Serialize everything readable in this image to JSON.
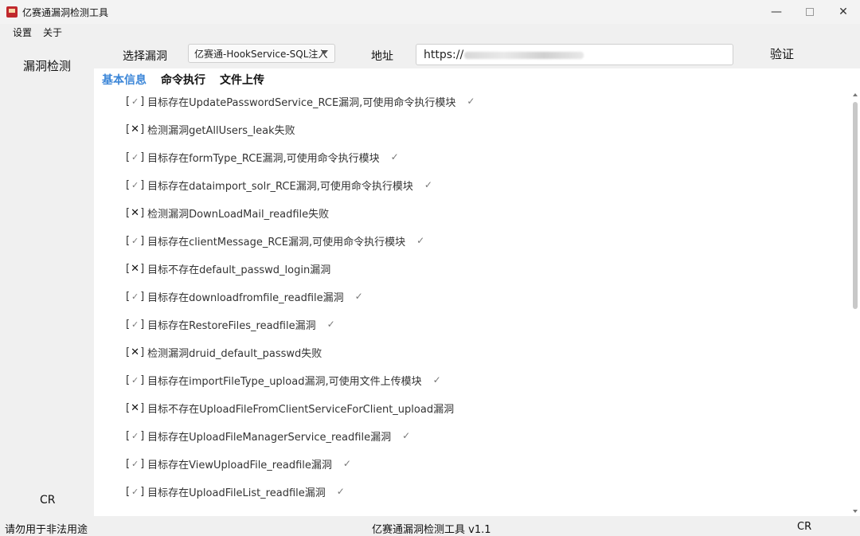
{
  "window": {
    "title": "亿赛通漏洞检测工具",
    "controls": {
      "minimize": "—",
      "maximize": "",
      "close": "✕"
    }
  },
  "menu": {
    "items": [
      "设置",
      "关于"
    ]
  },
  "leftnav": {
    "title": "漏洞检测",
    "footer": "CR"
  },
  "toolbar": {
    "select_label": "选择漏洞",
    "select_value": "亿赛通-HookService-SQL注入",
    "address_label": "地址",
    "address_value": "https://",
    "verify_label": "验证"
  },
  "tabs": [
    {
      "label": "基本信息",
      "active": true
    },
    {
      "label": "命令执行",
      "active": false
    },
    {
      "label": "文件上传",
      "active": false
    }
  ],
  "results": [
    {
      "status": "ok",
      "text": "目标存在UpdatePasswordService_RCE漏洞,可使用命令执行模块"
    },
    {
      "status": "fail",
      "text": "检测漏洞getAllUsers_leak失败"
    },
    {
      "status": "ok",
      "text": "目标存在formType_RCE漏洞,可使用命令执行模块"
    },
    {
      "status": "ok",
      "text": "目标存在dataimport_solr_RCE漏洞,可使用命令执行模块"
    },
    {
      "status": "fail",
      "text": "检测漏洞DownLoadMail_readfile失败"
    },
    {
      "status": "ok",
      "text": "目标存在clientMessage_RCE漏洞,可使用命令执行模块"
    },
    {
      "status": "fail",
      "text": "目标不存在default_passwd_login漏洞"
    },
    {
      "status": "ok",
      "text": "目标存在downloadfromfile_readfile漏洞"
    },
    {
      "status": "ok",
      "text": "目标存在RestoreFiles_readfile漏洞"
    },
    {
      "status": "fail",
      "text": "检测漏洞druid_default_passwd失败"
    },
    {
      "status": "ok",
      "text": "目标存在importFileType_upload漏洞,可使用文件上传模块"
    },
    {
      "status": "fail",
      "text": "目标不存在UploadFileFromClientServiceForClient_upload漏洞"
    },
    {
      "status": "ok",
      "text": "目标存在UploadFileManagerService_readfile漏洞"
    },
    {
      "status": "ok",
      "text": "目标存在ViewUploadFile_readfile漏洞"
    },
    {
      "status": "ok",
      "text": "目标存在UploadFileList_readfile漏洞"
    }
  ],
  "icons": {
    "ok": "check-icon",
    "fail": "cross-icon"
  },
  "status": {
    "left": "请勿用于非法用途",
    "center": "亿赛通漏洞检测工具 v1.1",
    "right": "CR"
  }
}
